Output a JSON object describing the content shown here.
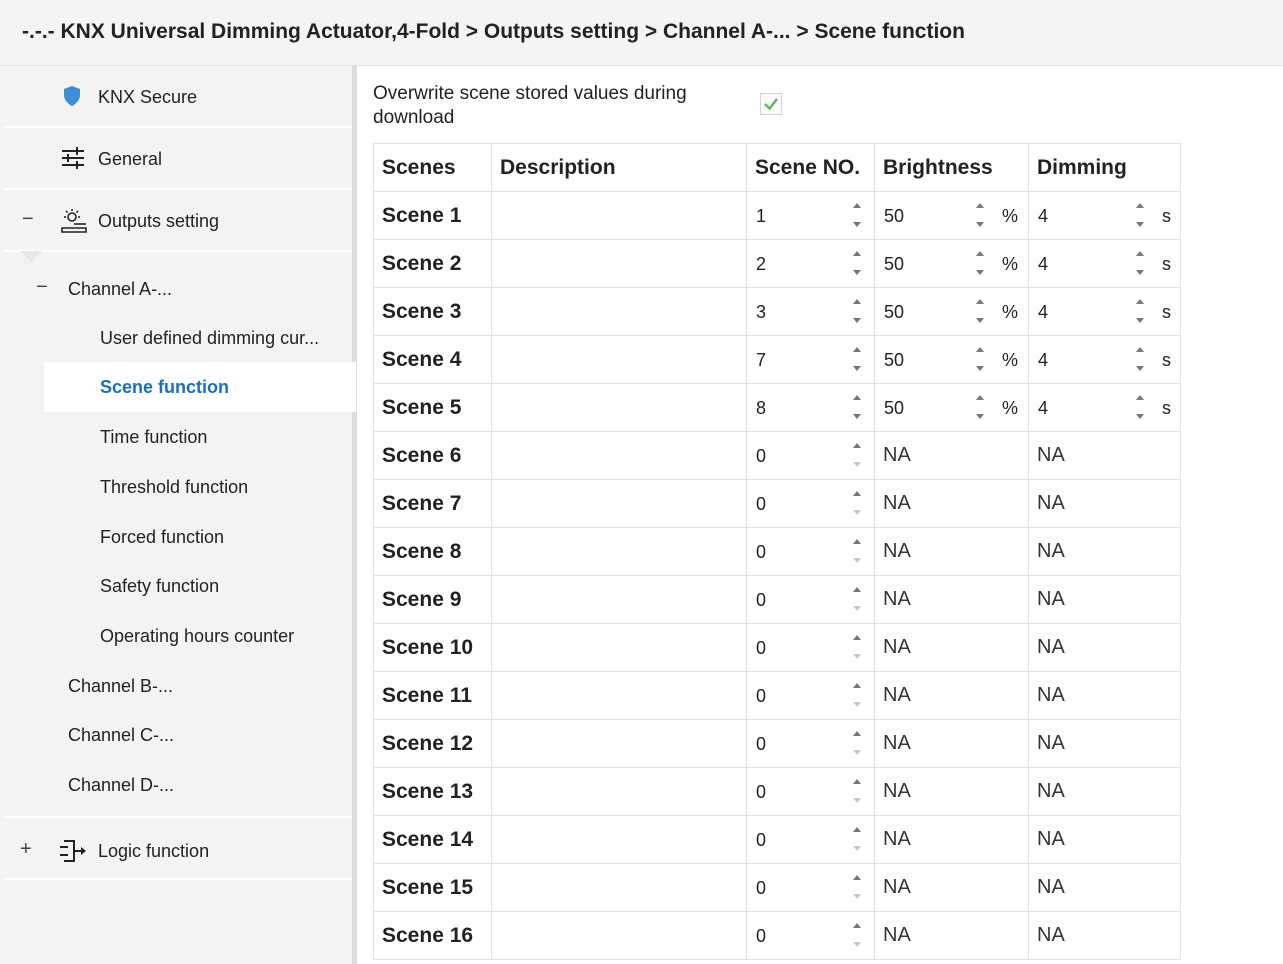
{
  "breadcrumb": "-.-.- KNX Universal Dimming Actuator,4-Fold > Outputs setting > Channel A-... > Scene function",
  "sidebar": {
    "knx_secure": "KNX Secure",
    "general": "General",
    "outputs_setting": "Outputs setting",
    "outputs_expander": "−",
    "channel_a": "Channel A-...",
    "channel_a_expander": "−",
    "sub_items": {
      "user_defined": "User defined dimming cur...",
      "scene_function": "Scene function",
      "time_function": "Time function",
      "threshold_function": "Threshold function",
      "forced_function": "Forced function",
      "safety_function": "Safety function",
      "operating_hours": "Operating hours counter"
    },
    "channel_b": "Channel B-...",
    "channel_c": "Channel C-...",
    "channel_d": "Channel D-...",
    "logic_function": "Logic function",
    "logic_expander": "+"
  },
  "overwrite": {
    "label": "Overwrite scene stored values during download",
    "checked": true
  },
  "table": {
    "headers": {
      "scenes": "Scenes",
      "description": "Description",
      "scene_no": "Scene NO.",
      "brightness": "Brightness",
      "dimming": "Dimming"
    },
    "brightness_unit": "%",
    "dimming_unit": "s",
    "rows": [
      {
        "name": "Scene 1",
        "description": "",
        "scene_no": "1",
        "brightness": "50",
        "dimming": "4"
      },
      {
        "name": "Scene 2",
        "description": "",
        "scene_no": "2",
        "brightness": "50",
        "dimming": "4"
      },
      {
        "name": "Scene 3",
        "description": "",
        "scene_no": "3",
        "brightness": "50",
        "dimming": "4"
      },
      {
        "name": "Scene 4",
        "description": "",
        "scene_no": "7",
        "brightness": "50",
        "dimming": "4"
      },
      {
        "name": "Scene 5",
        "description": "",
        "scene_no": "8",
        "brightness": "50",
        "dimming": "4"
      },
      {
        "name": "Scene 6",
        "description": "",
        "scene_no": "0",
        "brightness": "NA",
        "dimming": "NA"
      },
      {
        "name": "Scene 7",
        "description": "",
        "scene_no": "0",
        "brightness": "NA",
        "dimming": "NA"
      },
      {
        "name": "Scene 8",
        "description": "",
        "scene_no": "0",
        "brightness": "NA",
        "dimming": "NA"
      },
      {
        "name": "Scene 9",
        "description": "",
        "scene_no": "0",
        "brightness": "NA",
        "dimming": "NA"
      },
      {
        "name": "Scene 10",
        "description": "",
        "scene_no": "0",
        "brightness": "NA",
        "dimming": "NA"
      },
      {
        "name": "Scene 11",
        "description": "",
        "scene_no": "0",
        "brightness": "NA",
        "dimming": "NA"
      },
      {
        "name": "Scene 12",
        "description": "",
        "scene_no": "0",
        "brightness": "NA",
        "dimming": "NA"
      },
      {
        "name": "Scene 13",
        "description": "",
        "scene_no": "0",
        "brightness": "NA",
        "dimming": "NA"
      },
      {
        "name": "Scene 14",
        "description": "",
        "scene_no": "0",
        "brightness": "NA",
        "dimming": "NA"
      },
      {
        "name": "Scene 15",
        "description": "",
        "scene_no": "0",
        "brightness": "NA",
        "dimming": "NA"
      },
      {
        "name": "Scene 16",
        "description": "",
        "scene_no": "0",
        "brightness": "NA",
        "dimming": "NA"
      }
    ]
  },
  "colors": {
    "accent": "#1a6fbf",
    "shield": "#3a8fd8",
    "check": "#5cb85c"
  },
  "icons": {
    "knx_secure": "shield-icon",
    "general": "sliders-icon",
    "outputs_setting": "lamp-icon",
    "logic_function": "logic-icon",
    "spinner": "spinner-arrows-icon"
  }
}
